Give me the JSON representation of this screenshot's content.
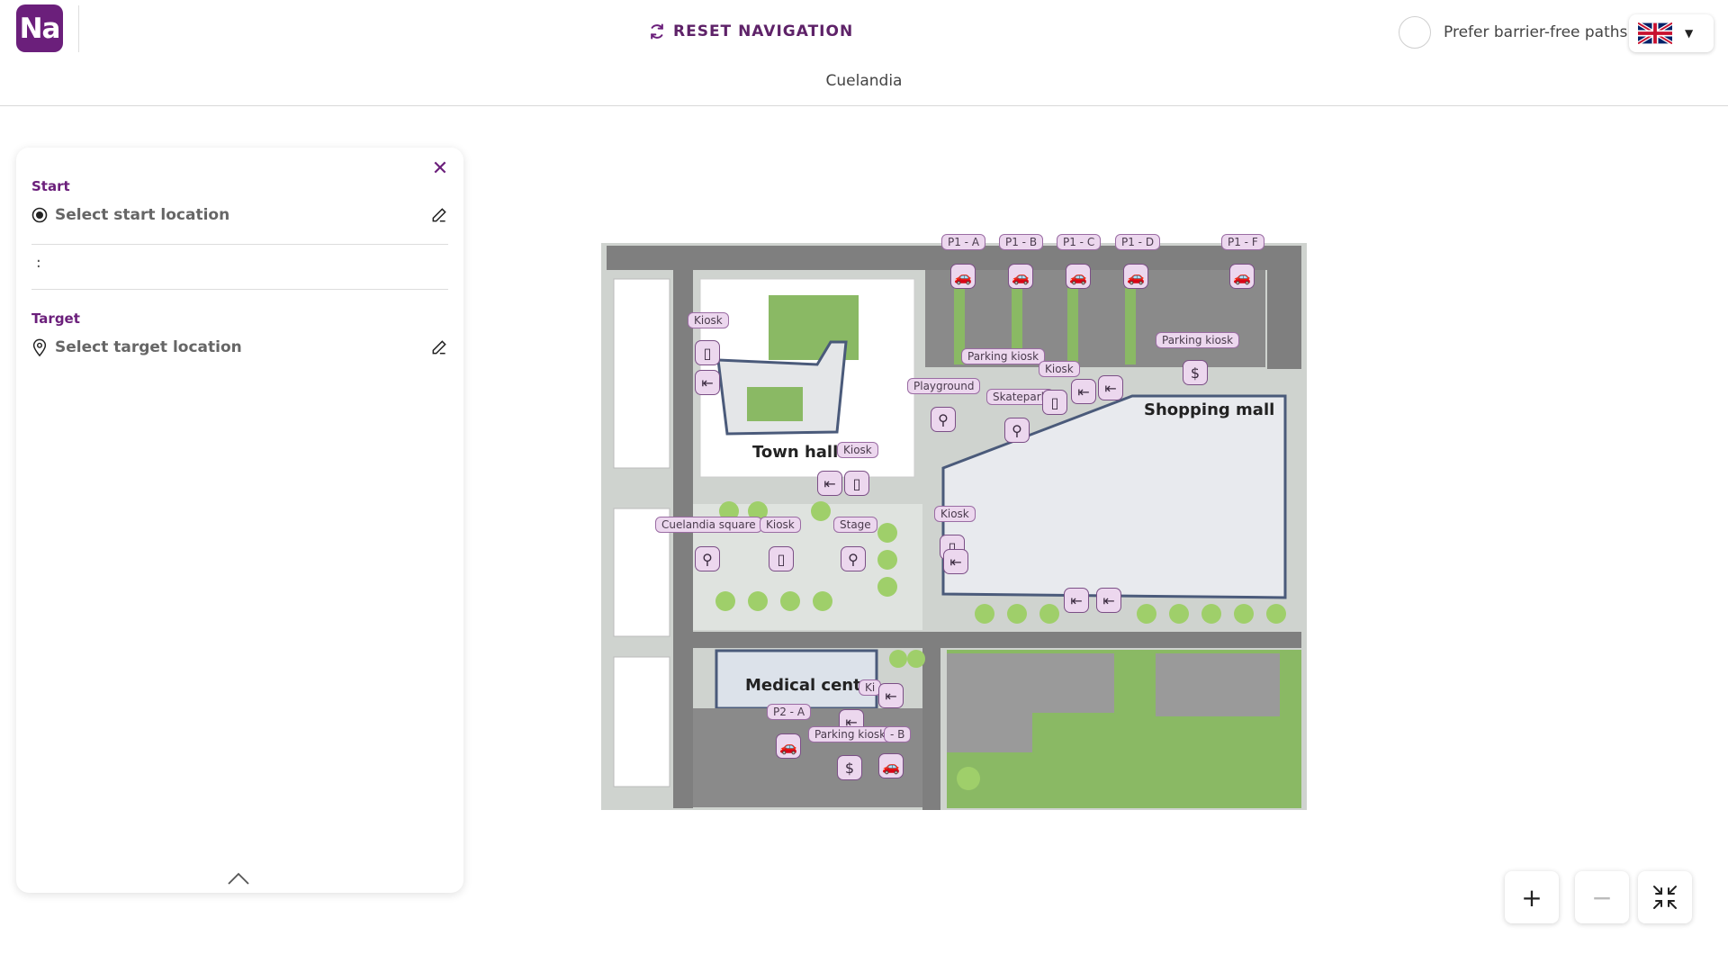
{
  "header": {
    "logo_text": "Na",
    "reset_label": "RESET NAVIGATION",
    "site_name": "Cuelandia",
    "barrier_free_label": "Prefer barrier-free paths",
    "language_icon": "uk-flag-icon"
  },
  "panel": {
    "start_label": "Start",
    "start_placeholder": "Select start location",
    "target_label": "Target",
    "target_placeholder": "Select target location"
  },
  "map": {
    "buildings": {
      "town_hall": "Town hall",
      "shopping_mall": "Shopping mall",
      "medical_center": "Medical center"
    },
    "labels": {
      "p1a": "P1 - A",
      "p1b": "P1 - B",
      "p1c": "P1 - C",
      "p1d": "P1 - D",
      "p1f": "P1 - F",
      "kiosk": "Kiosk",
      "parking_kiosk": "Parking kiosk",
      "playground": "Playground",
      "skatepark": "Skatepark",
      "cuelandia_square": "Cuelandia square",
      "stage": "Stage",
      "p2a": "P2 - A",
      "p2b": "- B",
      "kiosk_partial": "Ki"
    }
  },
  "zoom": {
    "in": "+",
    "out": "−"
  },
  "colors": {
    "brand": "#6b1f7b",
    "poi_fill": "#ecd7ee",
    "road": "#7f7f7f",
    "grass": "#8ab964",
    "plaza": "#dfe3df"
  }
}
